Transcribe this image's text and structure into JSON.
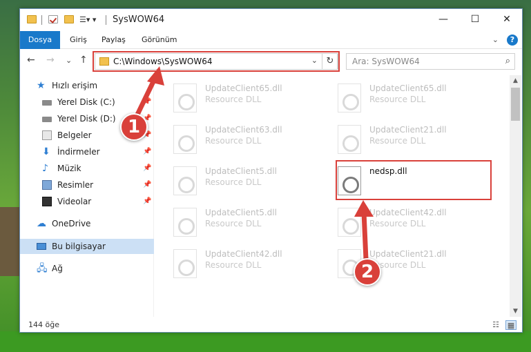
{
  "window": {
    "title": "SysWOW64",
    "controls": {
      "minimize": "—",
      "maximize": "☐",
      "close": "✕"
    }
  },
  "ribbon": {
    "tabs": [
      {
        "label": "Dosya"
      },
      {
        "label": "Giriş"
      },
      {
        "label": "Paylaş"
      },
      {
        "label": "Görünüm"
      }
    ]
  },
  "nav": {
    "back": "←",
    "forward": "→",
    "recent": "⌄",
    "up": "↑",
    "address": "C:\\Windows\\SysWOW64",
    "search_placeholder": "Ara: SysWOW64"
  },
  "sidebar": {
    "items": [
      {
        "label": "Hızlı erişim"
      },
      {
        "label": "Yerel Disk (C:)",
        "pinned": true
      },
      {
        "label": "Yerel Disk (D:)",
        "pinned": true
      },
      {
        "label": "Belgeler",
        "pinned": true
      },
      {
        "label": "İndirmeler",
        "pinned": true
      },
      {
        "label": "Müzik",
        "pinned": true
      },
      {
        "label": "Resimler",
        "pinned": true
      },
      {
        "label": "Videolar",
        "pinned": true
      },
      {
        "label": "OneDrive"
      },
      {
        "label": "Bu bilgisayar",
        "selected": true
      },
      {
        "label": "Ağ"
      }
    ]
  },
  "files": [
    {
      "name": "UpdateClient65.dll",
      "type": "Resource DLL"
    },
    {
      "name": "UpdateClient65.dll",
      "type": "Resource DLL"
    },
    {
      "name": "UpdateClient63.dll",
      "type": "Resource DLL"
    },
    {
      "name": "UpdateClient21.dll",
      "type": "Resource DLL"
    },
    {
      "name": "UpdateClient5.dll",
      "type": "Resource DLL"
    },
    {
      "name": "nedsp.dll",
      "type": "",
      "highlighted": true
    },
    {
      "name": "UpdateClient5.dll",
      "type": "Resource DLL"
    },
    {
      "name": "UpdateClient42.dll",
      "type": "Resource DLL"
    },
    {
      "name": "UpdateClient42.dll",
      "type": "Resource DLL"
    },
    {
      "name": "UpdateClient21.dll",
      "type": "Resource DLL"
    }
  ],
  "status": {
    "item_count": "144 öğe"
  },
  "annotations": {
    "marker_1": "1",
    "marker_2": "2",
    "color": "#d9403a"
  },
  "icons": {
    "search": "search-icon",
    "refresh": "refresh-icon",
    "pin": "pin-icon"
  }
}
